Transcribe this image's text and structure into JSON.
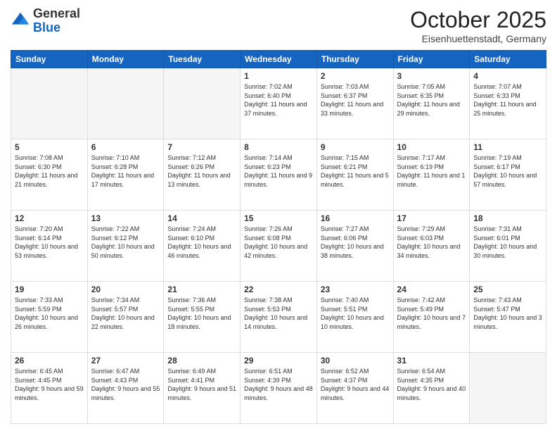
{
  "header": {
    "logo": {
      "general": "General",
      "blue": "Blue"
    },
    "title": "October 2025",
    "subtitle": "Eisenhuettenstadt, Germany"
  },
  "days_of_week": [
    "Sunday",
    "Monday",
    "Tuesday",
    "Wednesday",
    "Thursday",
    "Friday",
    "Saturday"
  ],
  "weeks": [
    [
      {
        "num": "",
        "empty": true
      },
      {
        "num": "",
        "empty": true
      },
      {
        "num": "",
        "empty": true
      },
      {
        "num": "1",
        "sunrise": "7:02 AM",
        "sunset": "6:40 PM",
        "daylight": "11 hours and 37 minutes."
      },
      {
        "num": "2",
        "sunrise": "7:03 AM",
        "sunset": "6:37 PM",
        "daylight": "11 hours and 33 minutes."
      },
      {
        "num": "3",
        "sunrise": "7:05 AM",
        "sunset": "6:35 PM",
        "daylight": "11 hours and 29 minutes."
      },
      {
        "num": "4",
        "sunrise": "7:07 AM",
        "sunset": "6:33 PM",
        "daylight": "11 hours and 25 minutes."
      }
    ],
    [
      {
        "num": "5",
        "sunrise": "7:08 AM",
        "sunset": "6:30 PM",
        "daylight": "11 hours and 21 minutes."
      },
      {
        "num": "6",
        "sunrise": "7:10 AM",
        "sunset": "6:28 PM",
        "daylight": "11 hours and 17 minutes."
      },
      {
        "num": "7",
        "sunrise": "7:12 AM",
        "sunset": "6:26 PM",
        "daylight": "11 hours and 13 minutes."
      },
      {
        "num": "8",
        "sunrise": "7:14 AM",
        "sunset": "6:23 PM",
        "daylight": "11 hours and 9 minutes."
      },
      {
        "num": "9",
        "sunrise": "7:15 AM",
        "sunset": "6:21 PM",
        "daylight": "11 hours and 5 minutes."
      },
      {
        "num": "10",
        "sunrise": "7:17 AM",
        "sunset": "6:19 PM",
        "daylight": "11 hours and 1 minute."
      },
      {
        "num": "11",
        "sunrise": "7:19 AM",
        "sunset": "6:17 PM",
        "daylight": "10 hours and 57 minutes."
      }
    ],
    [
      {
        "num": "12",
        "sunrise": "7:20 AM",
        "sunset": "6:14 PM",
        "daylight": "10 hours and 53 minutes."
      },
      {
        "num": "13",
        "sunrise": "7:22 AM",
        "sunset": "6:12 PM",
        "daylight": "10 hours and 50 minutes."
      },
      {
        "num": "14",
        "sunrise": "7:24 AM",
        "sunset": "6:10 PM",
        "daylight": "10 hours and 46 minutes."
      },
      {
        "num": "15",
        "sunrise": "7:26 AM",
        "sunset": "6:08 PM",
        "daylight": "10 hours and 42 minutes."
      },
      {
        "num": "16",
        "sunrise": "7:27 AM",
        "sunset": "6:06 PM",
        "daylight": "10 hours and 38 minutes."
      },
      {
        "num": "17",
        "sunrise": "7:29 AM",
        "sunset": "6:03 PM",
        "daylight": "10 hours and 34 minutes."
      },
      {
        "num": "18",
        "sunrise": "7:31 AM",
        "sunset": "6:01 PM",
        "daylight": "10 hours and 30 minutes."
      }
    ],
    [
      {
        "num": "19",
        "sunrise": "7:33 AM",
        "sunset": "5:59 PM",
        "daylight": "10 hours and 26 minutes."
      },
      {
        "num": "20",
        "sunrise": "7:34 AM",
        "sunset": "5:57 PM",
        "daylight": "10 hours and 22 minutes."
      },
      {
        "num": "21",
        "sunrise": "7:36 AM",
        "sunset": "5:55 PM",
        "daylight": "10 hours and 18 minutes."
      },
      {
        "num": "22",
        "sunrise": "7:38 AM",
        "sunset": "5:53 PM",
        "daylight": "10 hours and 14 minutes."
      },
      {
        "num": "23",
        "sunrise": "7:40 AM",
        "sunset": "5:51 PM",
        "daylight": "10 hours and 10 minutes."
      },
      {
        "num": "24",
        "sunrise": "7:42 AM",
        "sunset": "5:49 PM",
        "daylight": "10 hours and 7 minutes."
      },
      {
        "num": "25",
        "sunrise": "7:43 AM",
        "sunset": "5:47 PM",
        "daylight": "10 hours and 3 minutes."
      }
    ],
    [
      {
        "num": "26",
        "sunrise": "6:45 AM",
        "sunset": "4:45 PM",
        "daylight": "9 hours and 59 minutes."
      },
      {
        "num": "27",
        "sunrise": "6:47 AM",
        "sunset": "4:43 PM",
        "daylight": "9 hours and 55 minutes."
      },
      {
        "num": "28",
        "sunrise": "6:49 AM",
        "sunset": "4:41 PM",
        "daylight": "9 hours and 51 minutes."
      },
      {
        "num": "29",
        "sunrise": "6:51 AM",
        "sunset": "4:39 PM",
        "daylight": "9 hours and 48 minutes."
      },
      {
        "num": "30",
        "sunrise": "6:52 AM",
        "sunset": "4:37 PM",
        "daylight": "9 hours and 44 minutes."
      },
      {
        "num": "31",
        "sunrise": "6:54 AM",
        "sunset": "4:35 PM",
        "daylight": "9 hours and 40 minutes."
      },
      {
        "num": "",
        "empty": true
      }
    ]
  ],
  "labels": {
    "sunrise": "Sunrise:",
    "sunset": "Sunset:",
    "daylight": "Daylight:"
  }
}
